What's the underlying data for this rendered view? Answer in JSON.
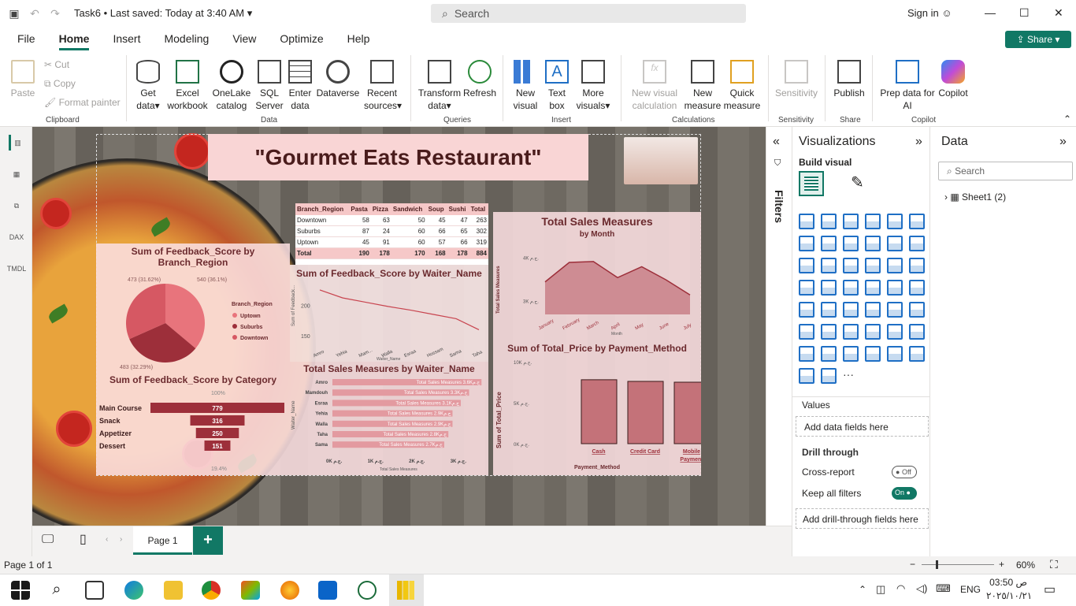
{
  "titlebar": {
    "doc_title": "Task6",
    "saved": "Last saved: Today at 3:40 AM",
    "search_placeholder": "Search",
    "signin": "Sign in"
  },
  "menu": {
    "items": [
      "File",
      "Home",
      "Insert",
      "Modeling",
      "View",
      "Optimize",
      "Help"
    ],
    "share": "Share"
  },
  "ribbon": {
    "clipboard": {
      "paste": "Paste",
      "cut": "Cut",
      "copy": "Copy",
      "format_painter": "Format painter",
      "group": "Clipboard"
    },
    "data": {
      "get_data": "Get data",
      "excel": "Excel workbook",
      "onelake": "OneLake catalog",
      "sql": "SQL Server",
      "enter": "Enter data",
      "dataverse": "Dataverse",
      "recent": "Recent sources",
      "group": "Data"
    },
    "queries": {
      "transform": "Transform data",
      "refresh": "Refresh",
      "group": "Queries"
    },
    "insert": {
      "new_visual": "New visual",
      "text_box": "Text box",
      "more_visuals": "More visuals",
      "group": "Insert"
    },
    "calculations": {
      "new_visual_calc": "New visual calculation",
      "new_measure": "New measure",
      "quick_measure": "Quick measure",
      "group": "Calculations"
    },
    "sensitivity": {
      "label": "Sensitivity",
      "group": "Sensitivity"
    },
    "share": {
      "publish": "Publish",
      "group": "Share"
    },
    "copilot": {
      "prep": "Prep data for AI",
      "copilot": "Copilot",
      "group": "Copilot"
    }
  },
  "report": {
    "title": "\"Gourmet Eats Restaurant\"",
    "matrix": {
      "headers": [
        "Branch_Region",
        "Pasta",
        "Pizza",
        "Sandwich",
        "Soup",
        "Sushi",
        "Total"
      ],
      "rows": [
        [
          "Downtown",
          "58",
          "63",
          "50",
          "45",
          "47",
          "263"
        ],
        [
          "Suburbs",
          "87",
          "24",
          "60",
          "66",
          "65",
          "302"
        ],
        [
          "Uptown",
          "45",
          "91",
          "60",
          "57",
          "66",
          "319"
        ]
      ],
      "total": [
        "Total",
        "190",
        "178",
        "170",
        "168",
        "178",
        "884"
      ]
    },
    "pie": {
      "title": "Sum of Feedback_Score by Branch_Region",
      "legend_title": "Branch_Region",
      "labels": [
        "473 (31.62%)",
        "540 (36.1%)",
        "483 (32.29%)"
      ]
    },
    "waiter_line": {
      "title": "Sum of Feedback_Score by Waiter_Name",
      "xlabel": "Waiter_Name",
      "ylabel": "Sum of Feedback...",
      "ticks_y": [
        "200",
        "150"
      ]
    },
    "sales_month": {
      "title": "Total Sales Measures",
      "subtitle": "by Month",
      "xlabel": "Month",
      "ylabel": "Total Sales Measures",
      "ticks_y": [
        "4K ج.م.",
        "3K ج.م."
      ]
    },
    "funnel": {
      "title": "Sum of Feedback_Score by Category",
      "top_pct": "100%",
      "bottom_pct": "19.4%"
    },
    "waiter_bar": {
      "title": "Total Sales Measures by Waiter_Name",
      "xlabel": "Total Sales Measures",
      "ylabel": "Waiter_Name",
      "ticks_x": [
        "0K ج.م.",
        "1K ج.م.",
        "2K ج.م.",
        "3K ج.م."
      ]
    },
    "payment": {
      "title": "Sum of Total_Price by Payment_Method",
      "xlabel": "Payment_Method",
      "ylabel": "Sum of Total_Price",
      "ticks_y": [
        "10K ج.م.",
        "5K ج.م.",
        "0K ج.م."
      ]
    }
  },
  "chart_data": [
    {
      "type": "pie",
      "title": "Sum of Feedback_Score by Branch_Region",
      "categories": [
        "Uptown",
        "Suburbs",
        "Downtown"
      ],
      "values": [
        540,
        483,
        473
      ],
      "colors": [
        "#e8747c",
        "#9d2f3a",
        "#d65863"
      ]
    },
    {
      "type": "line",
      "title": "Sum of Feedback_Score by Waiter_Name",
      "categories": [
        "Amro",
        "Yehia",
        "Mam...",
        "Walla",
        "Esraa",
        "Hossam",
        "Sama",
        "Taha"
      ],
      "values": [
        225,
        212,
        205,
        198,
        192,
        185,
        178,
        160
      ],
      "ylim": [
        140,
        230
      ]
    },
    {
      "type": "area",
      "title": "Total Sales Measures",
      "categories": [
        "January",
        "February",
        "March",
        "April",
        "May",
        "June",
        "July"
      ],
      "values": [
        3450,
        3900,
        3920,
        3550,
        3800,
        3500,
        3150
      ],
      "ylim": [
        2700,
        4300
      ]
    },
    {
      "type": "bar",
      "title": "Sum of Feedback_Score by Category",
      "categories": [
        "Main Course",
        "Snack",
        "Appetizer",
        "Dessert"
      ],
      "values": [
        779,
        316,
        250,
        151
      ]
    },
    {
      "type": "bar",
      "title": "Total Sales Measures by Waiter_Name",
      "categories": [
        "Amro",
        "Mamdouh",
        "Esraa",
        "Yehia",
        "Walla",
        "Taha",
        "Sama"
      ],
      "values": [
        3600,
        3300,
        3100,
        2900,
        2900,
        2800,
        2700
      ],
      "labels": [
        "Total Sales Measures 3.6Kج.م",
        "Total Sales Measures 3.3Kج.م",
        "Total Sales Measures 3.1Kج.م",
        "Total Sales Measures 2.9Kج.م",
        "Total Sales Measures 2.9Kج.م",
        "Total Sales Measures 2.8Kج.م",
        "Total Sales Measures 2.7Kج.م"
      ],
      "xlim": [
        0,
        3500
      ]
    },
    {
      "type": "bar",
      "title": "Sum of Total_Price by Payment_Method",
      "categories": [
        "Cash",
        "Credit Card",
        "Mobile Payment"
      ],
      "values": [
        7800,
        7600,
        7500
      ],
      "ylim": [
        0,
        10000
      ]
    }
  ],
  "filters": {
    "label": "Filters"
  },
  "viz": {
    "title": "Visualizations",
    "build": "Build visual",
    "values": "Values",
    "add_data": "Add data fields here",
    "drill": "Drill through",
    "cross": "Cross-report",
    "cross_state": "Off",
    "keep": "Keep all filters",
    "keep_state": "On",
    "add_drill": "Add drill-through fields here"
  },
  "data_pane": {
    "title": "Data",
    "search": "Search",
    "table": "Sheet1 (2)"
  },
  "pages": {
    "current": "Page 1",
    "add": "+"
  },
  "status": {
    "page": "Page 1 of 1",
    "zoom": "60%"
  },
  "taskbar": {
    "lang": "ENG",
    "time": "03:50 ص",
    "date": "٢٠٢٥/١٠/٢١"
  }
}
